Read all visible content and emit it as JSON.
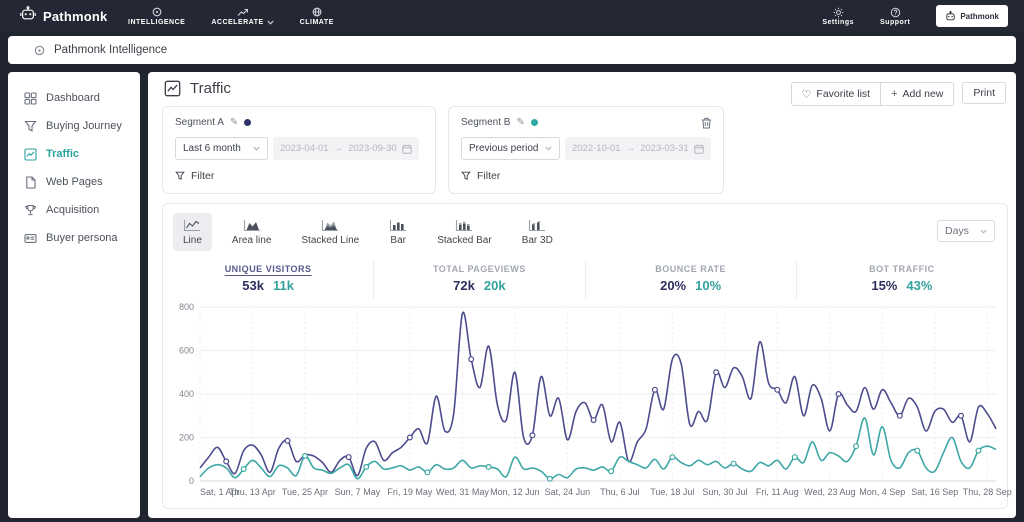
{
  "topbar": {
    "brand": "Pathmonk",
    "nav": [
      {
        "label": "INTELLIGENCE",
        "icon": "intelligence-icon"
      },
      {
        "label": "ACCELERATE",
        "icon": "accelerate-icon"
      },
      {
        "label": "CLIMATE",
        "icon": "climate-icon"
      }
    ],
    "right": [
      {
        "label": "Settings",
        "icon": "gear-icon"
      },
      {
        "label": "Support",
        "icon": "help-icon"
      }
    ],
    "account_button": "Pathmonk"
  },
  "subheader": {
    "title": "Pathmonk Intelligence"
  },
  "sidebar": {
    "items": [
      {
        "label": "Dashboard",
        "icon": "dashboard-icon",
        "active": false
      },
      {
        "label": "Buying Journey",
        "icon": "funnel-icon",
        "active": false
      },
      {
        "label": "Traffic",
        "icon": "traffic-chart-icon",
        "active": true
      },
      {
        "label": "Web Pages",
        "icon": "page-icon",
        "active": false
      },
      {
        "label": "Acquisition",
        "icon": "trophy-icon",
        "active": false
      },
      {
        "label": "Buyer persona",
        "icon": "persona-icon",
        "active": false
      }
    ]
  },
  "page": {
    "title": "Traffic",
    "actions": {
      "favorite": "Favorite list",
      "add_new": "Add new",
      "print": "Print"
    }
  },
  "ui": {
    "date_separator": "→"
  },
  "segments": [
    {
      "name": "Segment A",
      "color": "#32326b",
      "period_label": "Last 6 month",
      "date_from": "2023-04-01",
      "date_to": "2023-09-30",
      "filter_label": "Filter"
    },
    {
      "name": "Segment B",
      "color": "#2fa8a4",
      "period_label": "Previous period",
      "date_from": "2022-10-01",
      "date_to": "2023-03-31",
      "filter_label": "Filter"
    }
  ],
  "chart_controls": {
    "types": [
      {
        "label": "Line",
        "active": true
      },
      {
        "label": "Area line",
        "active": false
      },
      {
        "label": "Stacked Line",
        "active": false
      },
      {
        "label": "Bar",
        "active": false
      },
      {
        "label": "Stacked Bar",
        "active": false
      },
      {
        "label": "Bar 3D",
        "active": false
      }
    ],
    "granularity": "Days"
  },
  "metrics": [
    {
      "label": "UNIQUE VISITORS",
      "segment_a": "53k",
      "segment_b": "11k",
      "active": true
    },
    {
      "label": "TOTAL PAGEVIEWS",
      "segment_a": "72k",
      "segment_b": "20k",
      "active": false
    },
    {
      "label": "BOUNCE RATE",
      "segment_a": "20%",
      "segment_b": "10%",
      "active": false
    },
    {
      "label": "BOT TRAFFIC",
      "segment_a": "15%",
      "segment_b": "43%",
      "active": false
    }
  ],
  "chart_data": {
    "type": "line",
    "metric_shown": "UNIQUE VISITORS",
    "granularity": "Days",
    "x_labels": [
      "Sat, 1 Apr",
      "Thu, 13 Apr",
      "Tue, 25 Apr",
      "Sun, 7 May",
      "Fri, 19 May",
      "Wed, 31 May",
      "Mon, 12 Jun",
      "Sat, 24 Jun",
      "Thu, 6 Jul",
      "Tue, 18 Jul",
      "Sun, 30 Jul",
      "Fri, 11 Aug",
      "Wed, 23 Aug",
      "Mon, 4 Sep",
      "Sat, 16 Sep",
      "Thu, 28 Sep"
    ],
    "label_step": 6,
    "ylim": [
      0,
      800
    ],
    "yticks": [
      0,
      200,
      400,
      600,
      800
    ],
    "grid": true,
    "legend": "none",
    "series": [
      {
        "name": "Segment A",
        "color": "#4c4c8e",
        "values": [
          60,
          110,
          155,
          90,
          35,
          140,
          165,
          120,
          40,
          150,
          185,
          90,
          120,
          115,
          85,
          40,
          95,
          110,
          25,
          150,
          180,
          95,
          130,
          155,
          200,
          240,
          175,
          390,
          230,
          310,
          770,
          560,
          430,
          620,
          350,
          280,
          500,
          200,
          210,
          480,
          300,
          380,
          190,
          320,
          360,
          280,
          350,
          180,
          270,
          90,
          180,
          240,
          420,
          330,
          560,
          540,
          260,
          320,
          280,
          500,
          430,
          520,
          480,
          380,
          640,
          450,
          420,
          360,
          480,
          300,
          440,
          380,
          230,
          400,
          350,
          320,
          430,
          330,
          420,
          360,
          300,
          380,
          340,
          230,
          320,
          330,
          270,
          300,
          180,
          340,
          310,
          240
        ]
      },
      {
        "name": "Segment B",
        "color": "#3da8a4",
        "values": [
          20,
          60,
          75,
          60,
          15,
          55,
          95,
          60,
          20,
          70,
          60,
          25,
          115,
          60,
          50,
          35,
          60,
          75,
          10,
          65,
          90,
          55,
          60,
          70,
          50,
          65,
          40,
          75,
          55,
          60,
          95,
          60,
          70,
          65,
          55,
          20,
          110,
          55,
          60,
          45,
          10,
          30,
          15,
          55,
          60,
          50,
          65,
          45,
          110,
          90,
          75,
          60,
          100,
          55,
          110,
          85,
          70,
          95,
          75,
          90,
          60,
          80,
          55,
          45,
          85,
          70,
          95,
          55,
          110,
          85,
          180,
          95,
          130,
          115,
          90,
          160,
          290,
          120,
          250,
          95,
          60,
          130,
          140,
          60,
          45,
          130,
          200,
          90,
          60,
          140,
          160,
          145
        ]
      }
    ]
  }
}
